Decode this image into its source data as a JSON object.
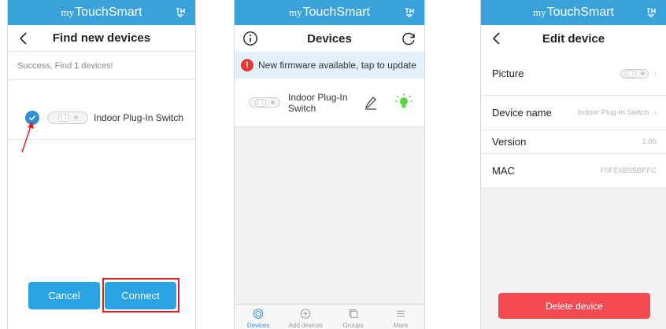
{
  "app": {
    "brand_prefix": "my",
    "brand_main": "TouchSmart"
  },
  "colors": {
    "status_bar": "#3aa2db",
    "accent": "#2e8fd6",
    "button": "#2aa3e3",
    "danger": "#f44b53",
    "highlight": "#e02020"
  },
  "find_screen": {
    "title": "Find new devices",
    "success_prefix": "Success, Find",
    "success_count": "1",
    "success_suffix": "devices!",
    "device_name": "Indoor Plug-In Switch",
    "cancel_label": "Cancel",
    "connect_label": "Connect",
    "icons": {
      "back": "chevron-left-icon",
      "check": "check-circle-icon",
      "pointer": "red-arrow-icon"
    }
  },
  "devices_screen": {
    "title": "Devices",
    "firmware_notice": "New firmware available, tap to update",
    "device_name": "Indoor Plug-In Switch",
    "tabs": [
      {
        "label": "Devices",
        "icon": "devices-icon",
        "active": true
      },
      {
        "label": "Add devices",
        "icon": "add-icon",
        "active": false
      },
      {
        "label": "Groups",
        "icon": "groups-icon",
        "active": false
      },
      {
        "label": "More",
        "icon": "menu-icon",
        "active": false
      }
    ],
    "icons": {
      "info": "info-icon",
      "refresh": "refresh-icon",
      "edit": "pencil-icon",
      "bulb": "bulb-icon"
    }
  },
  "edit_screen": {
    "title": "Edit device",
    "fields": {
      "picture_label": "Picture",
      "name_label": "Device name",
      "name_value": "Indoor Plug-In Switch",
      "version_label": "Version",
      "version_value": "1.00",
      "mac_label": "MAC",
      "mac_value": "F0FE6B9BBFFC"
    },
    "delete_label": "Delete device"
  }
}
